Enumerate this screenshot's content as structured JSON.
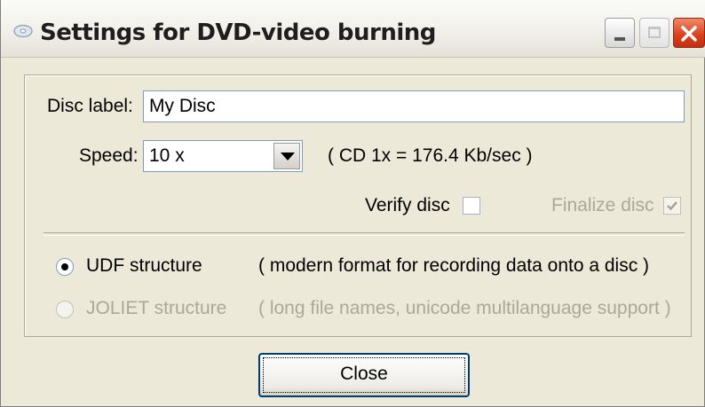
{
  "window": {
    "title": "Settings for DVD-video burning",
    "title_icon": "disc-icon",
    "controls": {
      "minimize": "minimize-icon",
      "maximize": "maximize-icon",
      "close": "close-icon"
    }
  },
  "form": {
    "disc_label": {
      "label": "Disc label:",
      "value": "My Disc"
    },
    "speed": {
      "label": "Speed:",
      "value": "10 x",
      "note": "( CD 1x = 176.4 Kb/sec )"
    },
    "verify_disc": {
      "label": "Verify disc",
      "checked": false,
      "enabled": true
    },
    "finalize_disc": {
      "label": "Finalize disc",
      "checked": true,
      "enabled": false
    }
  },
  "structure": {
    "udf": {
      "label": "UDF structure",
      "description": "( modern format for recording data onto a disc )",
      "selected": true,
      "enabled": true
    },
    "joliet": {
      "label": "JOLIET structure",
      "description": "( long file names, unicode multilanguage support )",
      "selected": false,
      "enabled": false
    }
  },
  "buttons": {
    "close_label": "Close"
  },
  "colors": {
    "close_button_red": "#d8401c",
    "disabled_text": "#aca899",
    "focus_border": "#003c74"
  }
}
